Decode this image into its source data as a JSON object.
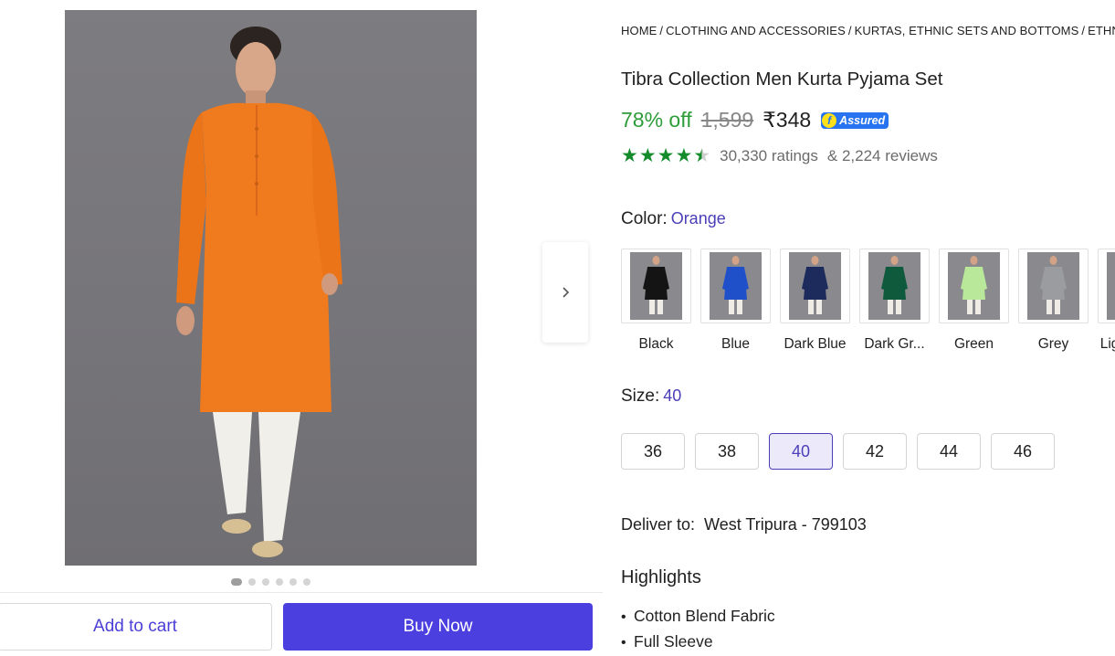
{
  "breadcrumb": [
    {
      "label": "HOME"
    },
    {
      "label": "CLOTHING AND ACCESSORIES"
    },
    {
      "label": "KURTAS, ETHNIC SETS AND BOTTOMS"
    },
    {
      "label": "ETHNIC SETS"
    }
  ],
  "breadcrumb_separator": "/",
  "product": {
    "title": "Tibra Collection Men Kurta Pyjama Set",
    "discount": "78% off",
    "mrp": "1,599",
    "price": "₹348",
    "assured_label": "Assured",
    "rating_stars": 4.5,
    "ratings_count": "30,330 ratings",
    "reviews_count": "& 2,224 reviews"
  },
  "color": {
    "label": "Color:",
    "selected": "Orange",
    "options": [
      {
        "name": "Black",
        "hex": "#141414"
      },
      {
        "name": "Blue",
        "hex": "#1f4fc9"
      },
      {
        "name": "Dark Blue",
        "hex": "#1c2a5c"
      },
      {
        "name": "Dark Gr...",
        "hex": "#0f5a3c"
      },
      {
        "name": "Green",
        "hex": "#b9e89a"
      },
      {
        "name": "Grey",
        "hex": "#9a9ca0"
      },
      {
        "name": "Light Grey",
        "hex": "#c7c9cc"
      }
    ]
  },
  "size": {
    "label": "Size:",
    "selected": "40",
    "options": [
      "36",
      "38",
      "40",
      "42",
      "44",
      "46"
    ]
  },
  "delivery": {
    "label": "Deliver to:",
    "location": "West Tripura - 799103"
  },
  "highlights": {
    "title": "Highlights",
    "items": [
      "Cotton Blend Fabric",
      "Full Sleeve"
    ]
  },
  "actions": {
    "add_to_cart": "Add to cart",
    "buy_now": "Buy Now"
  },
  "gallery": {
    "image_count": 6,
    "active_index": 0,
    "main_kurta_color": "#f07a1e"
  },
  "colors": {
    "accent": "#4b3fe0",
    "discount_green": "#2f9c3a",
    "star_green": "#148c2b"
  }
}
